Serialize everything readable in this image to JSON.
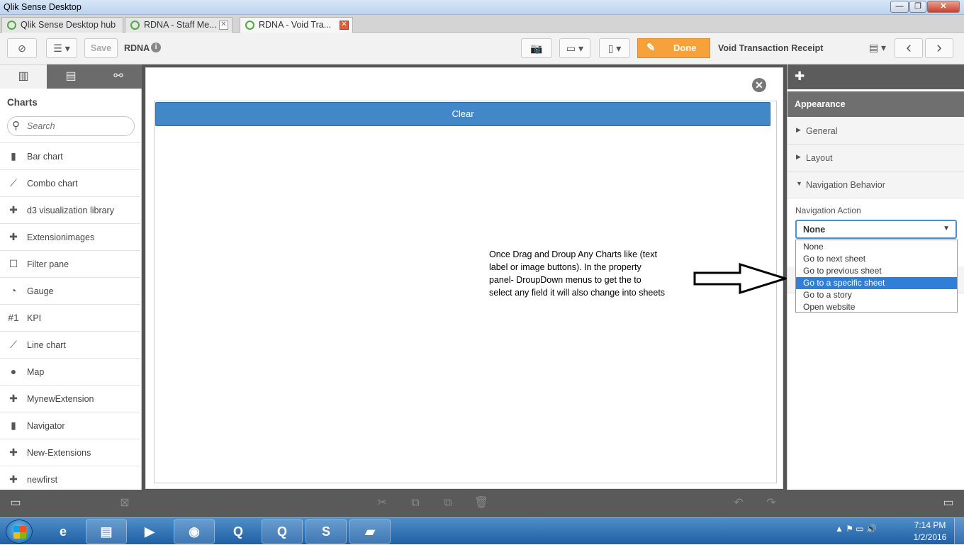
{
  "window": {
    "title": "Qlik Sense Desktop",
    "minimize": "—",
    "maximize": "❐",
    "close": "✕"
  },
  "tabs": [
    {
      "label": "Qlik Sense Desktop hub",
      "close": ""
    },
    {
      "label": "RDNA - Staff Me...",
      "close": "✕"
    },
    {
      "label": "RDNA - Void Tra...",
      "close": "✕"
    }
  ],
  "toolbar": {
    "save_label": "Save",
    "app_name": "RDNA",
    "info": "i",
    "done_label": "Done",
    "sheet_title": "Void Transaction Receipt",
    "icons": {
      "nav": "⊘",
      "list": "☰ ▾",
      "camera": "📷",
      "present": "▭ ▾",
      "bookmark": "▯ ▾",
      "sheets": "▤ ▾",
      "prev": "‹",
      "next": "›",
      "pencil": "✎"
    }
  },
  "left_panel": {
    "tabs": [
      {
        "icon": "▥"
      },
      {
        "icon": "▤"
      },
      {
        "icon": "⚯"
      }
    ],
    "heading": "Charts",
    "search_placeholder": "Search",
    "items": [
      {
        "label": "Bar chart",
        "icon": "▮"
      },
      {
        "label": "Combo chart",
        "icon": "⟋"
      },
      {
        "label": "d3 visualization library",
        "icon": "✚"
      },
      {
        "label": "Extensionimages",
        "icon": "✚"
      },
      {
        "label": "Filter pane",
        "icon": "☐"
      },
      {
        "label": "Gauge",
        "icon": "◔"
      },
      {
        "label": "KPI",
        "icon": "#1"
      },
      {
        "label": "Line chart",
        "icon": "⟋"
      },
      {
        "label": "Map",
        "icon": "●"
      },
      {
        "label": "MynewExtension",
        "icon": "✚"
      },
      {
        "label": "Navigator",
        "icon": "▮"
      },
      {
        "label": "New-Extensions",
        "icon": "✚"
      },
      {
        "label": "newfirst",
        "icon": "✚"
      }
    ]
  },
  "canvas": {
    "close_icon": "✕",
    "button_label": "Clear",
    "annotation": "Once Drag and Droup Any Charts like (text label  or image buttons). In the property panel- DroupDown menus to get the to select any field it will also change into sheets"
  },
  "right_panel": {
    "puzzle_icon": "✚",
    "header": "Appearance",
    "sections": [
      {
        "label": "General",
        "tri": "▶"
      },
      {
        "label": "Layout",
        "tri": "▶"
      },
      {
        "label": "Navigation Behavior",
        "tri": "▼"
      }
    ],
    "nav_action_label": "Navigation Action",
    "nav_selected": "None",
    "caret": "▼",
    "options": [
      "None",
      "Go to next sheet",
      "Go to previous sheet",
      "Go to a specific sheet",
      "Go to a story",
      "Open website"
    ],
    "highlighted_option": 3
  },
  "bottom_bar": {
    "icons": {
      "left_panel_toggle": "▭",
      "formula": "⊠",
      "cut": "✂",
      "copy": "⧉",
      "paste": "⧉",
      "delete": "🗑",
      "undo": "↶",
      "redo": "↷",
      "right_panel_toggle": "▭"
    }
  },
  "taskbar": {
    "apps": [
      {
        "icon": "e"
      },
      {
        "icon": "▤"
      },
      {
        "icon": "▶"
      },
      {
        "icon": "◉"
      },
      {
        "icon": "Q"
      },
      {
        "icon": "Q"
      },
      {
        "icon": "S"
      },
      {
        "icon": "▰"
      }
    ],
    "tray_icons": "▲  ⚑  ▭  🔊",
    "time": "7:14 PM",
    "date": "1/2/2016"
  }
}
